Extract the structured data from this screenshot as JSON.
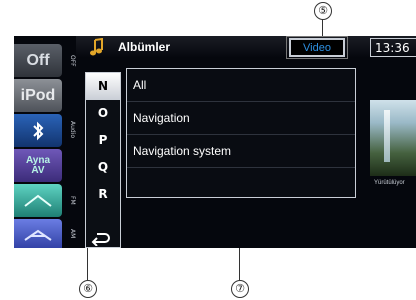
{
  "header": {
    "title": "Albümler",
    "video_label": "Video",
    "clock": "13:36"
  },
  "sources": [
    {
      "label": "Off",
      "tag": "OFF"
    },
    {
      "label": "iPod",
      "tag": ""
    },
    {
      "label": "",
      "tag": "Audio"
    },
    {
      "label": "Ayna AV",
      "tag": ""
    },
    {
      "label": "",
      "tag": "FM"
    },
    {
      "label": "",
      "tag": "AM"
    }
  ],
  "index_letters": [
    "N",
    "O",
    "P",
    "Q",
    "R"
  ],
  "selected_letter": "N",
  "list_items": [
    "All",
    "Navigation",
    "Navigation system"
  ],
  "now_playing": "Yürütülüyor",
  "callouts": {
    "video": "⑤",
    "letters": "⑥",
    "list": "⑦"
  },
  "colors": {
    "accent": "#2d8fe0",
    "background": "#05070d"
  }
}
